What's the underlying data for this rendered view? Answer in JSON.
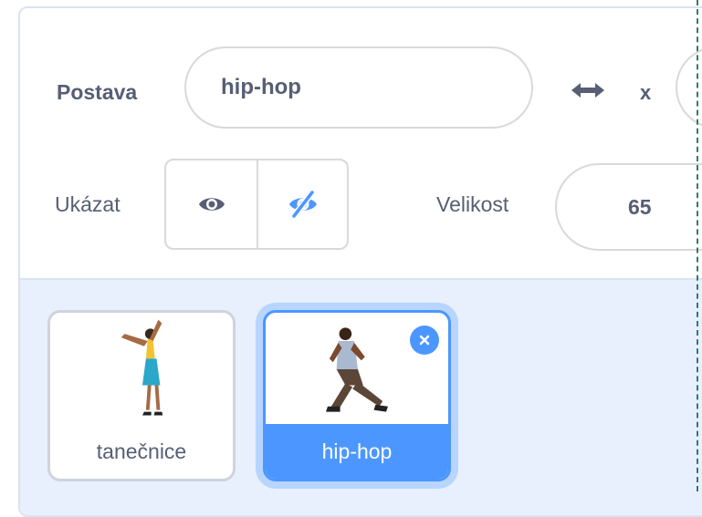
{
  "sprite_info": {
    "sprite_label": "Postava",
    "sprite_name": "hip-hop",
    "x_label": "x",
    "show_label": "Ukázat",
    "size_label": "Velikost",
    "size_value": "65"
  },
  "sprites": [
    {
      "name": "tanečnice",
      "selected": false
    },
    {
      "name": "hip-hop",
      "selected": true
    }
  ],
  "colors": {
    "accent": "#4c97ff",
    "text": "#575e75",
    "sprite_area_bg": "#e8f0fd"
  }
}
